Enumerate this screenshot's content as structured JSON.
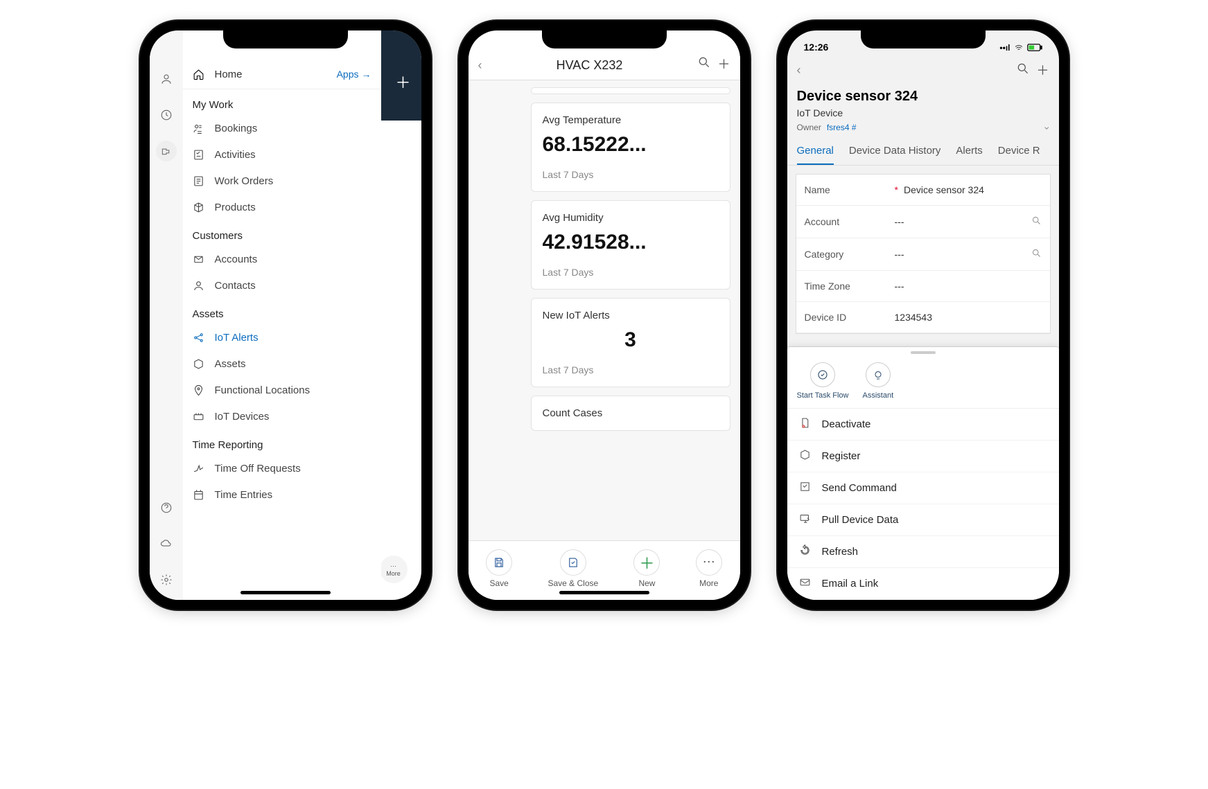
{
  "phone1": {
    "home": "Home",
    "apps": "Apps",
    "more": "More",
    "sections": {
      "mywork": {
        "title": "My Work",
        "items": [
          "Bookings",
          "Activities",
          "Work Orders",
          "Products"
        ]
      },
      "customers": {
        "title": "Customers",
        "items": [
          "Accounts",
          "Contacts"
        ]
      },
      "assets": {
        "title": "Assets",
        "items": [
          "IoT Alerts",
          "Assets",
          "Functional Locations",
          "IoT Devices"
        ]
      },
      "time": {
        "title": "Time Reporting",
        "items": [
          "Time Off Requests",
          "Time Entries"
        ]
      }
    }
  },
  "phone2": {
    "title": "HVAC X232",
    "cards": [
      {
        "label": "Avg Temperature",
        "value": "68.15222...",
        "sub": "Last 7 Days"
      },
      {
        "label": "Avg Humidity",
        "value": "42.91528...",
        "sub": "Last 7 Days"
      },
      {
        "label": "New IoT Alerts",
        "value": "3",
        "sub": "Last 7 Days",
        "center": true
      },
      {
        "label": "Count Cases",
        "value": "",
        "sub": ""
      }
    ],
    "bar": [
      "Save",
      "Save & Close",
      "New",
      "More"
    ]
  },
  "phone3": {
    "time": "12:26",
    "title": "Device sensor 324",
    "subtitle": "IoT Device",
    "ownerLabel": "Owner",
    "ownerValue": "fsres4 #",
    "tabs": [
      "General",
      "Device Data History",
      "Alerts",
      "Device R"
    ],
    "fields": [
      {
        "label": "Name",
        "required": true,
        "value": "Device sensor 324"
      },
      {
        "label": "Account",
        "value": "---",
        "search": true
      },
      {
        "label": "Category",
        "value": "---",
        "search": true
      },
      {
        "label": "Time Zone",
        "value": "---"
      },
      {
        "label": "Device ID",
        "value": "1234543"
      }
    ],
    "chips": [
      "Start Task Flow",
      "Assistant"
    ],
    "actions": [
      "Deactivate",
      "Register",
      "Send Command",
      "Pull Device Data",
      "Refresh",
      "Email a Link"
    ]
  }
}
